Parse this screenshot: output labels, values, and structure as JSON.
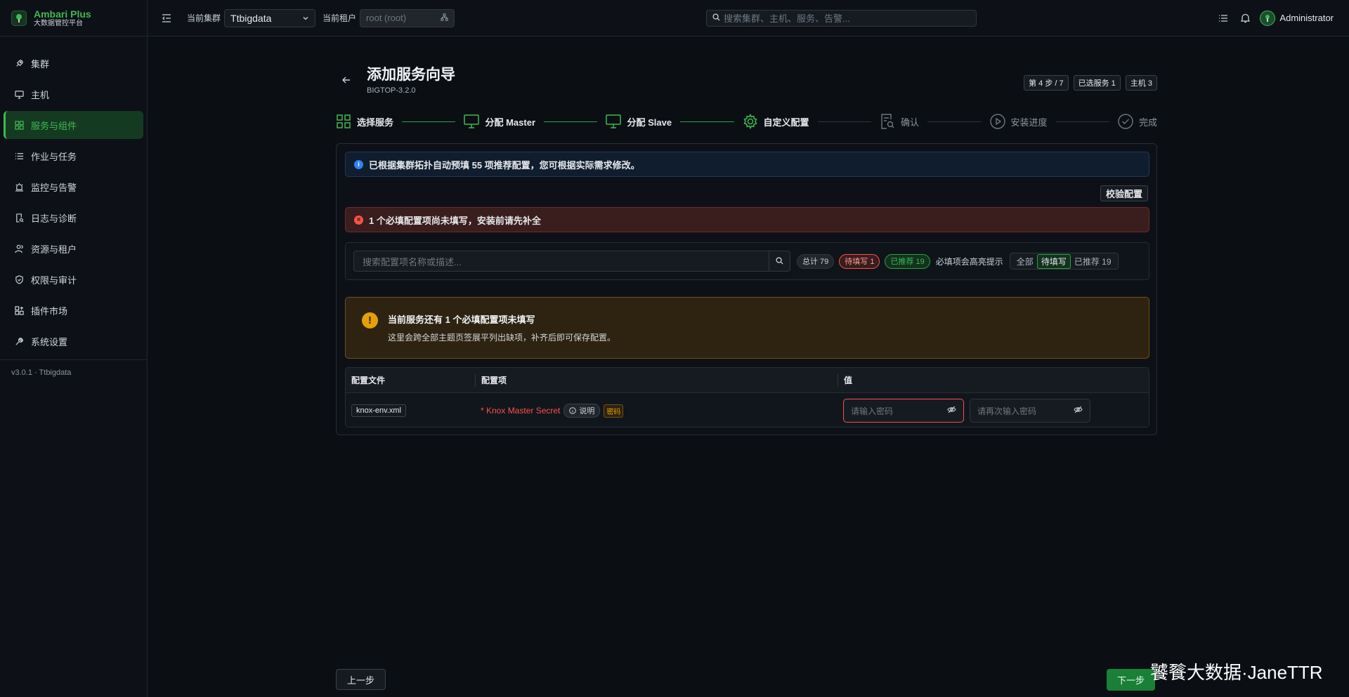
{
  "brand": {
    "name": "Ambari Plus",
    "subtitle": "大数据管控平台"
  },
  "sidebar": {
    "items": [
      {
        "label": "集群",
        "icon": "rocket-icon",
        "active": false
      },
      {
        "label": "主机",
        "icon": "monitor-icon",
        "active": false
      },
      {
        "label": "服务与组件",
        "icon": "grid-icon",
        "active": true
      },
      {
        "label": "作业与任务",
        "icon": "list-icon",
        "active": false
      },
      {
        "label": "监控与告警",
        "icon": "alarm-icon",
        "active": false
      },
      {
        "label": "日志与诊断",
        "icon": "log-search-icon",
        "active": false
      },
      {
        "label": "资源与租户",
        "icon": "users-icon",
        "active": false
      },
      {
        "label": "权限与审计",
        "icon": "shield-check-icon",
        "active": false
      },
      {
        "label": "插件市场",
        "icon": "plugin-icon",
        "active": false
      },
      {
        "label": "系统设置",
        "icon": "wrench-icon",
        "active": false
      }
    ],
    "version": "v3.0.1 · Ttbigdata"
  },
  "topbar": {
    "cluster_label": "当前集群",
    "cluster_value": "Ttbigdata",
    "tenant_label": "当前租户",
    "tenant_placeholder": "root (root)",
    "search_placeholder": "搜索集群、主机、服务、告警...",
    "user": "Administrator"
  },
  "wizard": {
    "title": "添加服务向导",
    "subtitle": "BIGTOP-3.2.0",
    "badges": [
      "第 4 步 / 7",
      "已选服务 1",
      "主机 3"
    ],
    "steps": [
      {
        "label": "选择服务",
        "state": "done",
        "icon": "grid-icon"
      },
      {
        "label": "分配 Master",
        "state": "done",
        "icon": "monitor-icon"
      },
      {
        "label": "分配 Slave",
        "state": "done",
        "icon": "monitor-icon"
      },
      {
        "label": "自定义配置",
        "state": "current",
        "icon": "gear-icon"
      },
      {
        "label": "确认",
        "state": "todo",
        "icon": "doc-search-icon"
      },
      {
        "label": "安装进度",
        "state": "todo",
        "icon": "play-circle-icon"
      },
      {
        "label": "完成",
        "state": "todo",
        "icon": "check-circle-icon"
      }
    ],
    "info_text": "已根据集群拓扑自动预填 55 项推荐配置，您可根据实际需求修改。",
    "validate_label": "校验配置",
    "error_text": "1 个必填配置项尚未填写，安装前请先补全",
    "filter": {
      "search_placeholder": "搜索配置项名称或描述...",
      "total": "总计 79",
      "pending": "待填写 1",
      "recommended": "已推荐 19",
      "hint": "必填项会高亮提示",
      "segments": [
        "全部",
        "待填写",
        "已推荐 19"
      ],
      "active_segment": 1
    },
    "warning": {
      "title": "当前服务还有 1 个必填配置项未填写",
      "desc": "这里会跨全部主题页签展平列出缺项，补齐后即可保存配置。"
    },
    "table": {
      "headers": [
        "配置文件",
        "配置项",
        "值"
      ],
      "rows": [
        {
          "file": "knox-env.xml",
          "name": "* Knox Master Secret",
          "explain": "说明",
          "tag": "密码",
          "pw_placeholder": "请输入密码",
          "pw_confirm_placeholder": "请再次输入密码"
        }
      ]
    },
    "prev_label": "上一步",
    "next_label": "下一步"
  },
  "watermark": "饕餮大数据·JaneTTR",
  "colors": {
    "accent": "#3fb950",
    "error": "#f85149",
    "warning": "#e3a008",
    "info": "#2f81f7"
  }
}
